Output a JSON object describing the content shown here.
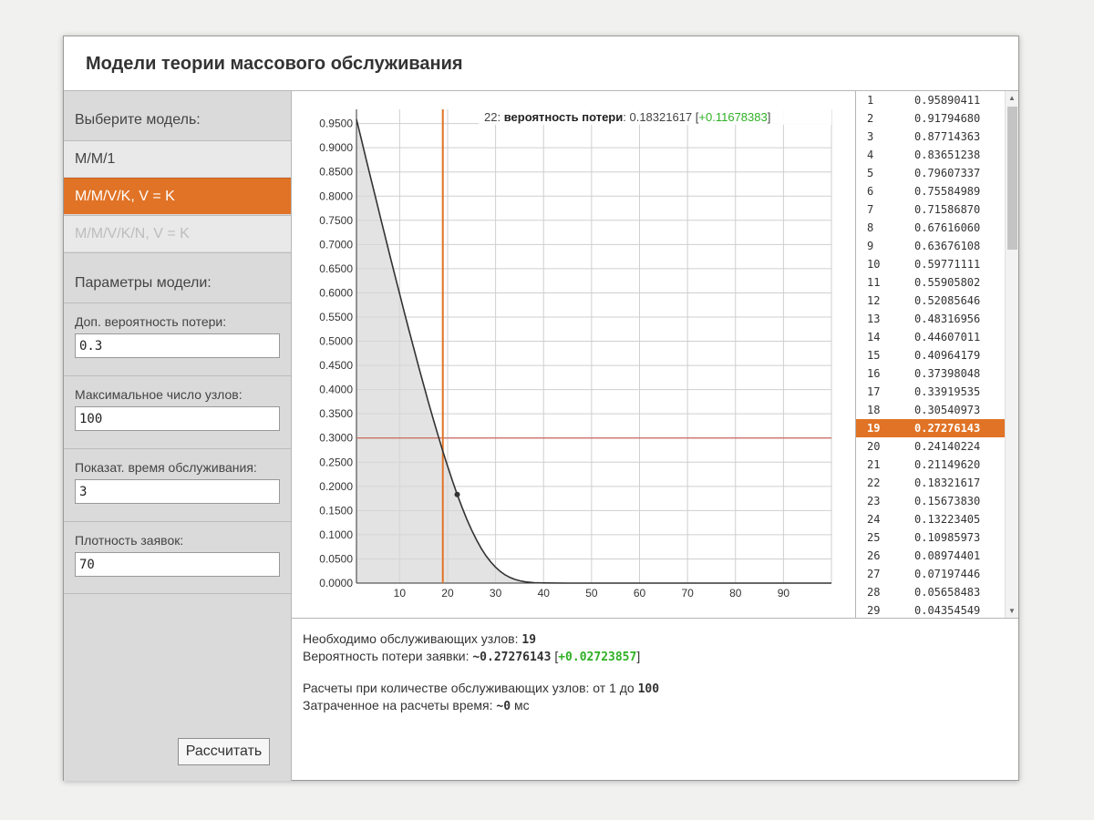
{
  "header": {
    "title": "Модели теории массового обслуживания"
  },
  "sidebar": {
    "choose_label": "Выберите модель:",
    "models": [
      {
        "label": "M/M/1",
        "state": "normal"
      },
      {
        "label": "M/M/V/K, V = K",
        "state": "active"
      },
      {
        "label": "M/M/V/K/N, V = K",
        "state": "disabled"
      }
    ],
    "params_label": "Параметры модели:",
    "params": [
      {
        "label": "Доп. вероятность потери:",
        "value": "0.3"
      },
      {
        "label": "Максимальное число узлов:",
        "value": "100"
      },
      {
        "label": "Показат. время обслуживания:",
        "value": "3"
      },
      {
        "label": "Плотность заявок:",
        "value": "70"
      }
    ],
    "calculate_label": "Рассчитать"
  },
  "chart_data": {
    "type": "line",
    "tooltip": {
      "n": "22:",
      "label": "вероятность потери",
      "value": "0.18321617",
      "delta": "+0.11678383"
    },
    "xlim": [
      1,
      100
    ],
    "ylim": [
      0,
      0.97
    ],
    "x_ticks": [
      10,
      20,
      30,
      40,
      50,
      60,
      70,
      80,
      90
    ],
    "y_ticks": [
      "0.0000",
      "0.0500",
      "0.1000",
      "0.1500",
      "0.2000",
      "0.2500",
      "0.3000",
      "0.3500",
      "0.4000",
      "0.4500",
      "0.5000",
      "0.5500",
      "0.6000",
      "0.6500",
      "0.7000",
      "0.7500",
      "0.8000",
      "0.8500",
      "0.9000",
      "0.9500"
    ],
    "threshold_y": 0.3,
    "marker_x": 19,
    "hover_point": {
      "x": 22,
      "y": 0.18321617
    },
    "series": [
      {
        "x": [
          1,
          2,
          3,
          4,
          5,
          6,
          7,
          8,
          9,
          10,
          11,
          12,
          13,
          14,
          15,
          16,
          17,
          18,
          19,
          20,
          21,
          22,
          23,
          24,
          25,
          26,
          27,
          28,
          29,
          30,
          31,
          32,
          33,
          34,
          35,
          36,
          37,
          38,
          40,
          45,
          50,
          60,
          70,
          80,
          90,
          100
        ],
        "values": [
          0.95890411,
          0.9179468,
          0.87714363,
          0.83651238,
          0.79607337,
          0.75584989,
          0.7158687,
          0.6761606,
          0.63676108,
          0.59771111,
          0.55905802,
          0.52085646,
          0.48316956,
          0.44607011,
          0.40964179,
          0.37398048,
          0.33919535,
          0.30540973,
          0.27276143,
          0.24140224,
          0.2114962,
          0.18321617,
          0.1567383,
          0.13223405,
          0.10985973,
          0.08974401,
          0.07197446,
          0.05658483,
          0.04354549,
          0.0327,
          0.0239,
          0.0169,
          0.0116,
          0.0077,
          0.0049,
          0.003,
          0.0018,
          0.001,
          0.0003,
          0.0,
          0.0,
          0.0,
          0.0,
          0.0,
          0.0,
          0.0
        ]
      }
    ],
    "colors": {
      "curve": "#333333",
      "marker": "#e07326",
      "threshold": "#c8675a",
      "fill": "#d7d7d7",
      "grid": "#cfcfcf"
    }
  },
  "table": {
    "rows": [
      {
        "n": "1",
        "v": "0.95890411"
      },
      {
        "n": "2",
        "v": "0.91794680"
      },
      {
        "n": "3",
        "v": "0.87714363"
      },
      {
        "n": "4",
        "v": "0.83651238"
      },
      {
        "n": "5",
        "v": "0.79607337"
      },
      {
        "n": "6",
        "v": "0.75584989"
      },
      {
        "n": "7",
        "v": "0.71586870"
      },
      {
        "n": "8",
        "v": "0.67616060"
      },
      {
        "n": "9",
        "v": "0.63676108"
      },
      {
        "n": "10",
        "v": "0.59771111"
      },
      {
        "n": "11",
        "v": "0.55905802"
      },
      {
        "n": "12",
        "v": "0.52085646"
      },
      {
        "n": "13",
        "v": "0.48316956"
      },
      {
        "n": "14",
        "v": "0.44607011"
      },
      {
        "n": "15",
        "v": "0.40964179"
      },
      {
        "n": "16",
        "v": "0.37398048"
      },
      {
        "n": "17",
        "v": "0.33919535"
      },
      {
        "n": "18",
        "v": "0.30540973"
      },
      {
        "n": "19",
        "v": "0.27276143",
        "selected": true
      },
      {
        "n": "20",
        "v": "0.24140224"
      },
      {
        "n": "21",
        "v": "0.21149620"
      },
      {
        "n": "22",
        "v": "0.18321617"
      },
      {
        "n": "23",
        "v": "0.15673830"
      },
      {
        "n": "24",
        "v": "0.13223405"
      },
      {
        "n": "25",
        "v": "0.10985973"
      },
      {
        "n": "26",
        "v": "0.08974401"
      },
      {
        "n": "27",
        "v": "0.07197446"
      },
      {
        "n": "28",
        "v": "0.05658483"
      },
      {
        "n": "29",
        "v": "0.04354549"
      }
    ]
  },
  "results": {
    "nodes_label": "Необходимо обслуживающих узлов:",
    "nodes_value": "19",
    "loss_label": "Вероятность потери заявки:",
    "loss_value": "~0.27276143",
    "loss_delta": "+0.02723857",
    "range_label": "Расчеты при количестве обслуживающих узлов: от 1 до",
    "range_value": "100",
    "time_label": "Затраченное на расчеты время:",
    "time_value": "~0",
    "time_unit": "мс"
  }
}
